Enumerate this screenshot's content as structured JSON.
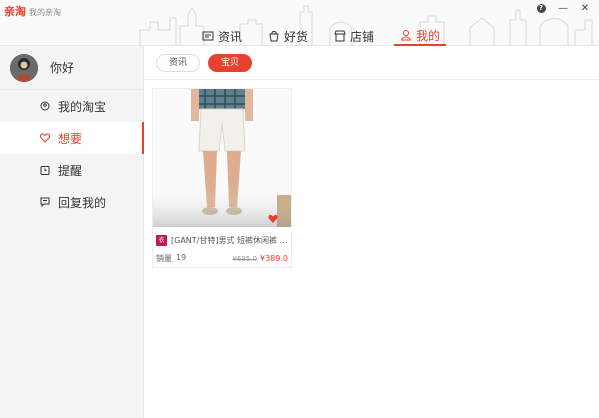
{
  "app": {
    "logo": "亲淘",
    "subtitle": "我的亲淘"
  },
  "window": {
    "help_label": "?",
    "minimize_label": "—",
    "close_label": "✕"
  },
  "nav": {
    "tabs": [
      {
        "label": "资讯",
        "icon": "news-icon",
        "active": false
      },
      {
        "label": "好货",
        "icon": "bag-icon",
        "active": false
      },
      {
        "label": "店铺",
        "icon": "shop-icon",
        "active": false
      },
      {
        "label": "我的",
        "icon": "user-icon",
        "active": true
      }
    ]
  },
  "profile": {
    "name": "你好"
  },
  "sidebar": {
    "items": [
      {
        "label": "我的淘宝",
        "icon": "taobao-icon",
        "active": false
      },
      {
        "label": "想要",
        "icon": "heart-icon",
        "active": true
      },
      {
        "label": "提醒",
        "icon": "alarm-icon",
        "active": false
      },
      {
        "label": "回复我的",
        "icon": "comment-icon",
        "active": false
      }
    ]
  },
  "subtabs": {
    "items": [
      {
        "label": "资讯",
        "active": false
      },
      {
        "label": "宝贝",
        "active": true
      }
    ]
  },
  "product": {
    "tag": "衣",
    "title": "[GANT/甘特]男式 短裤休闲裤 夏...",
    "sales_label": "销量",
    "sales_count": "19",
    "old_price": "¥695.0",
    "new_price": "¥389.0"
  },
  "colors": {
    "accent": "#e8412e",
    "sidebar_bg": "#f4f4f4"
  }
}
